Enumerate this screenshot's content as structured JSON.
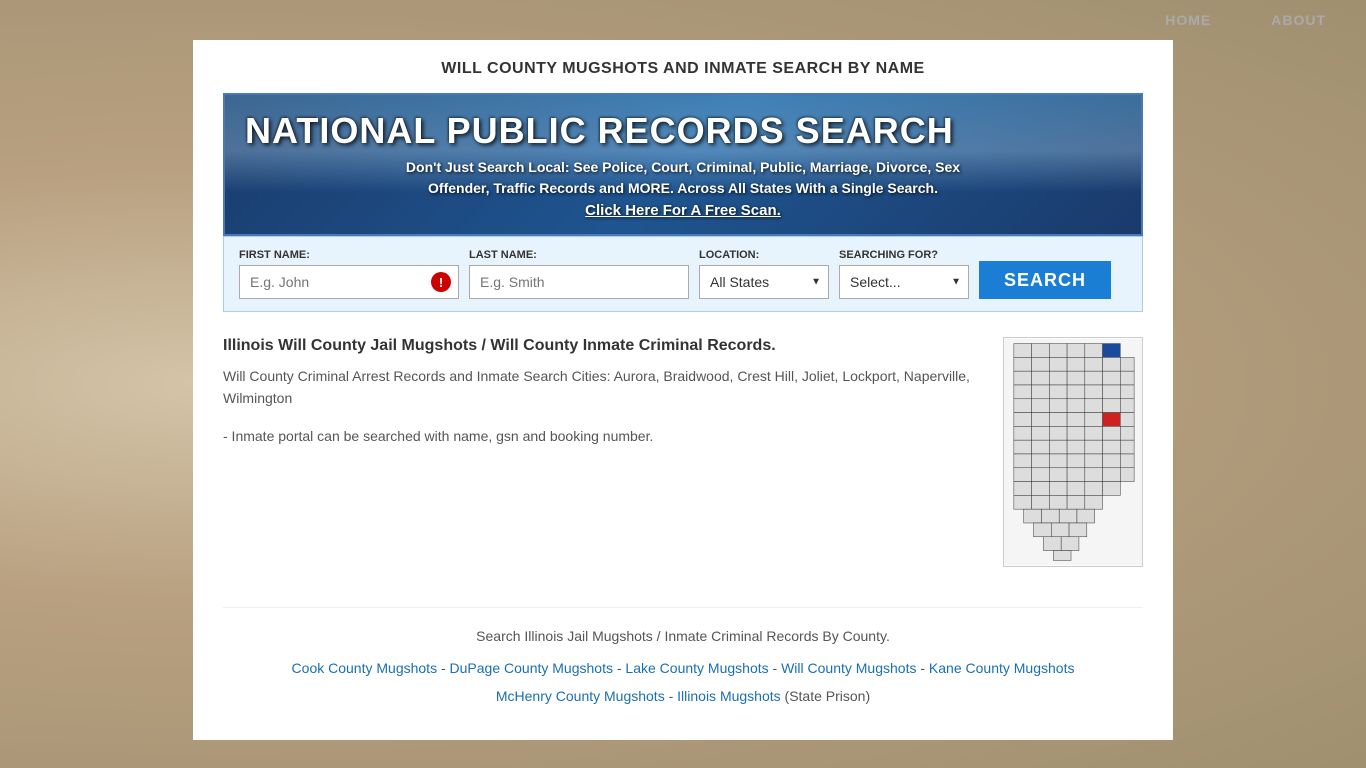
{
  "nav": {
    "home_label": "HOME",
    "about_label": "ABOUT"
  },
  "page": {
    "title": "WILL COUNTY MUGSHOTS AND INMATE SEARCH BY NAME"
  },
  "banner": {
    "title": "NATIONAL PUBLIC RECORDS SEARCH",
    "subtitle": "Don't Just Search Local: See Police, Court, Criminal, Public, Marriage, Divorce, Sex\nOffender, Traffic Records and MORE. Across All States With a Single Search.",
    "cta": "Click Here For A Free Scan."
  },
  "search_form": {
    "first_name_label": "FIRST NAME:",
    "first_name_placeholder": "E.g. John",
    "last_name_label": "LAST NAME:",
    "last_name_placeholder": "E.g. Smith",
    "location_label": "LOCATION:",
    "location_value": "All States",
    "searching_for_label": "SEARCHING FOR?",
    "searching_for_placeholder": "Select...",
    "search_button_label": "SEARCH"
  },
  "content": {
    "heading": "Illinois Will County Jail Mugshots / Will County Inmate Criminal Records.",
    "body": "Will County Criminal Arrest Records and Inmate Search Cities: Aurora, Braidwood, Crest Hill, Joliet, Lockport, Naperville, Wilmington",
    "note": "- Inmate portal can be searched with name, gsn and booking number."
  },
  "footer": {
    "text": "Search Illinois Jail Mugshots / Inmate Criminal Records By County.",
    "links": [
      {
        "label": "Cook County Mugshots",
        "href": "#"
      },
      {
        "label": "DuPage County Mugshots",
        "href": "#"
      },
      {
        "label": "Lake County Mugshots",
        "href": "#"
      },
      {
        "label": "Will County Mugshots",
        "href": "#"
      },
      {
        "label": "Kane County Mugshots",
        "href": "#"
      },
      {
        "label": "McHenry County Mugshots",
        "href": "#"
      },
      {
        "label": "Illinois Mugshots",
        "href": "#"
      }
    ],
    "state_prison_label": "(State Prison)"
  }
}
